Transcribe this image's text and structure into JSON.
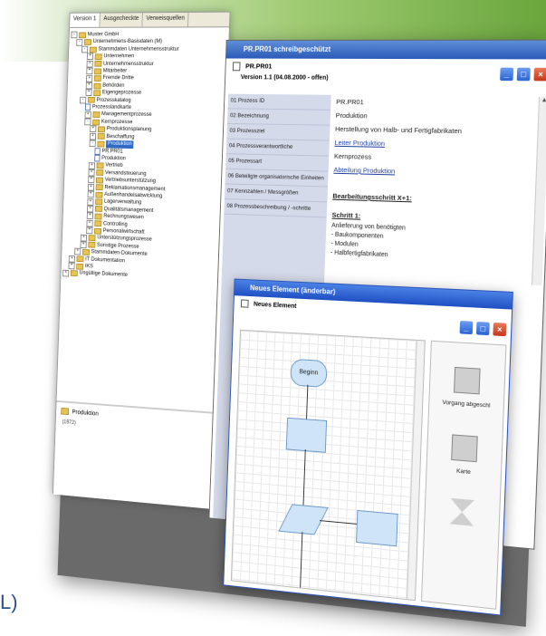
{
  "tree_panel": {
    "tabs": [
      "Version 1",
      "Ausgecheckte",
      "Verweisquellen"
    ],
    "nodes": [
      {
        "depth": 0,
        "label": "Muster GmbH",
        "exp": "-",
        "icon": "fold"
      },
      {
        "depth": 1,
        "label": "Unternehmens-Basisdaten (M)",
        "exp": "-",
        "icon": "fold"
      },
      {
        "depth": 2,
        "label": "Stammdaten Unternehmensstruktur",
        "exp": "-",
        "icon": "fold"
      },
      {
        "depth": 3,
        "label": "Unternehmen",
        "exp": "+",
        "icon": "fold"
      },
      {
        "depth": 3,
        "label": "Unternehmensstruktur",
        "exp": "+",
        "icon": "fold"
      },
      {
        "depth": 3,
        "label": "Mitarbeiter",
        "exp": "+",
        "icon": "fold"
      },
      {
        "depth": 3,
        "label": "Fremde Dritte",
        "exp": "+",
        "icon": "fold"
      },
      {
        "depth": 3,
        "label": "Behörden",
        "exp": "+",
        "icon": "fold"
      },
      {
        "depth": 3,
        "label": "Eigengeprozesse",
        "exp": "+",
        "icon": "fold"
      },
      {
        "depth": 2,
        "label": "Prozesskatalog",
        "exp": "-",
        "icon": "fold"
      },
      {
        "depth": 3,
        "label": "Prozesslandkarte",
        "exp": "",
        "icon": "doc"
      },
      {
        "depth": 3,
        "label": "Managementprozesse",
        "exp": "+",
        "icon": "fold"
      },
      {
        "depth": 3,
        "label": "Kernprozesse",
        "exp": "-",
        "icon": "fold"
      },
      {
        "depth": 4,
        "label": "Produktionsplanung",
        "exp": "+",
        "icon": "fold"
      },
      {
        "depth": 4,
        "label": "Beschaffung",
        "exp": "+",
        "icon": "fold"
      },
      {
        "depth": 4,
        "label": "Produktion",
        "exp": "-",
        "icon": "fold",
        "selected": true
      },
      {
        "depth": 5,
        "label": "PR.PR01",
        "exp": "",
        "icon": "doc"
      },
      {
        "depth": 5,
        "label": "Produktion",
        "exp": "",
        "icon": "doc"
      },
      {
        "depth": 4,
        "label": "Vertrieb",
        "exp": "+",
        "icon": "fold"
      },
      {
        "depth": 4,
        "label": "Versandsteuerung",
        "exp": "+",
        "icon": "fold"
      },
      {
        "depth": 4,
        "label": "Vertriebsunterstützung",
        "exp": "+",
        "icon": "fold"
      },
      {
        "depth": 4,
        "label": "Reklamationsmanagement",
        "exp": "+",
        "icon": "fold"
      },
      {
        "depth": 4,
        "label": "Außenhandelsabwicklung",
        "exp": "+",
        "icon": "fold"
      },
      {
        "depth": 4,
        "label": "Lagerverwaltung",
        "exp": "+",
        "icon": "fold"
      },
      {
        "depth": 4,
        "label": "Qualitätsmanagement",
        "exp": "+",
        "icon": "fold"
      },
      {
        "depth": 4,
        "label": "Rechnungswesen",
        "exp": "+",
        "icon": "fold"
      },
      {
        "depth": 4,
        "label": "Controlling",
        "exp": "+",
        "icon": "fold"
      },
      {
        "depth": 4,
        "label": "Personalwirtschaft",
        "exp": "+",
        "icon": "fold"
      },
      {
        "depth": 3,
        "label": "Unterstützungsprozesse",
        "exp": "+",
        "icon": "fold"
      },
      {
        "depth": 3,
        "label": "Sonstige Prozesse",
        "exp": "+",
        "icon": "fold"
      },
      {
        "depth": 2,
        "label": "Stammdaten-Dokumente",
        "exp": "+",
        "icon": "fold"
      },
      {
        "depth": 1,
        "label": "IT Dokumentation",
        "exp": "+",
        "icon": "fold"
      },
      {
        "depth": 1,
        "label": "IKS",
        "exp": "+",
        "icon": "fold"
      },
      {
        "depth": 0,
        "label": "Ungültige Dokumente",
        "exp": "+",
        "icon": "fold"
      }
    ],
    "bottom_title": "Produktion",
    "bottom_sub": "(1972)"
  },
  "window": {
    "title": "PR.PR01 schreibgeschützt",
    "doc_id": "PR.PR01",
    "version": "Version 1.1 (04.08.2000 - offen)",
    "properties": [
      "01 Prozess ID",
      "02 Bezeichnung",
      "03 Prozessziel",
      "04 Prozessverantwortliche",
      "05 Prozessart",
      "06 Beteiligte organisatorische Einheiten",
      "07 Kennzahlen / Messgrößen",
      "08 Prozessbeschreibung / -schritte"
    ],
    "values": [
      {
        "text": "PR.PR01",
        "cls": ""
      },
      {
        "text": "Produktion",
        "cls": ""
      },
      {
        "text": "Herstellung von Halb- und Fertigfabrikaten",
        "cls": ""
      },
      {
        "text": "Leiter Produktion",
        "cls": "link"
      },
      {
        "text": "Kernprozess",
        "cls": ""
      },
      {
        "text": "Abteilung Produktion",
        "cls": "link"
      }
    ],
    "step_heading": "Bearbeitungsschritt X+1:",
    "step_title": "Schritt 1:",
    "step_lines": [
      "Anlieferung von benötigten",
      "- Baukomponenten",
      "- Modulen",
      "- Halbfertigfabrikaten"
    ]
  },
  "dialog": {
    "title": "Neues Element (änderbar)",
    "sub": "Neues Element",
    "start_label": "Beginn",
    "palette": [
      "Vorgang abgeschl",
      "Karte"
    ]
  },
  "cut_text": "L)"
}
